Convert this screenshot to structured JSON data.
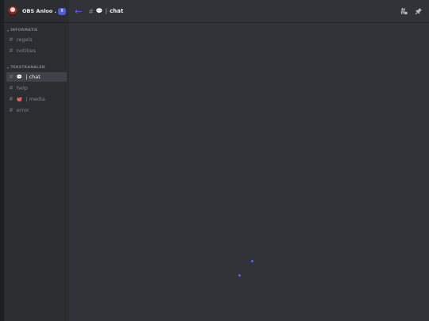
{
  "server": {
    "name": "OBS Anloo ...",
    "badge": "8"
  },
  "categories": [
    {
      "label": "INFORMATIE",
      "channels": [
        {
          "name": "regels"
        },
        {
          "name": "notities"
        }
      ]
    },
    {
      "label": "TEKSTKANALEN",
      "channels": [
        {
          "name": "chat",
          "emoji": "💬",
          "separator": "|",
          "active": true
        },
        {
          "name": "help"
        },
        {
          "name": "media",
          "emoji": "🐙",
          "separator": "|"
        },
        {
          "name": "error"
        }
      ]
    }
  ],
  "channel_header": {
    "emoji": "💬",
    "separator": "|",
    "name": "chat"
  },
  "colors": {
    "accent": "#5865f2",
    "sidebar": "#2b2d31",
    "main": "#313338"
  }
}
